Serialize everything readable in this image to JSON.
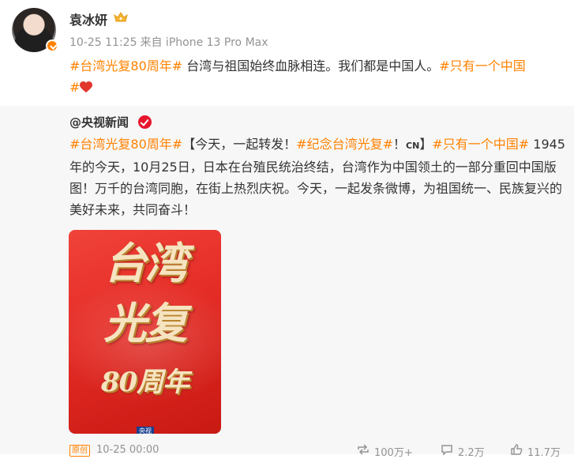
{
  "post": {
    "username": "袁冰妍",
    "crown_icon": "crown-icon",
    "verified_icon": "verified-badge-icon",
    "time": "10-25 11:25",
    "source": "来自 iPhone 13 Pro Max",
    "text": {
      "topic1": "#台湾光复80周年#",
      "body": " 台湾与祖国始终血脉相连。我们都是中国人。",
      "topic2": "#只有一个中国",
      "topic2_end": "#",
      "heart_icon": "heart-icon"
    }
  },
  "repost": {
    "author": "@央视新闻",
    "verified_icon": "red-verified-icon",
    "text": {
      "topic1": "#台湾光复80周年#",
      "part1": "【今天，一起转发！",
      "topic2": "#纪念台湾光复#",
      "part2": "！",
      "cn_badge": "CN",
      "part3": "】",
      "topic3": "#只有一个中国#",
      "part4": " 1945年的今天，10月25日，日本在台殖民统治终结，台湾作为中国领土的一部分重回中国版图！万千的台湾同胞，在街上热烈庆祝。今天，一起发条微博，为祖国统一、民族复兴的美好未来，共同奋斗！"
    },
    "poster": {
      "line1": "台湾",
      "line2": "光复",
      "line3": "80周年",
      "logo": "央视"
    },
    "footer": {
      "tag": "原创",
      "time": "10-25 00:00",
      "reposts": "100万+",
      "comments": "2.2万",
      "likes": "11.7万"
    }
  },
  "colors": {
    "topic": "#ff8200",
    "meta": "#939393",
    "repost_bg": "#f7f7f7",
    "poster_red": "#e42b25"
  }
}
